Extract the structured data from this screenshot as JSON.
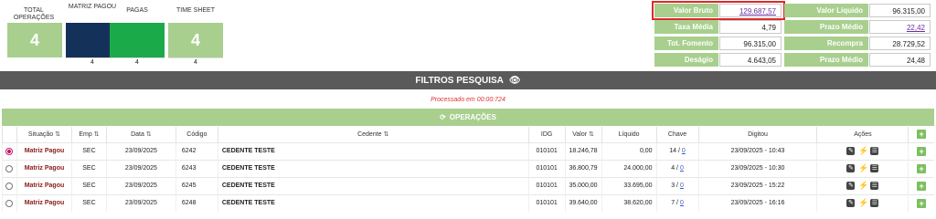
{
  "cards": [
    {
      "label": "TOTAL OPERAÇÕES",
      "value": "4",
      "color": "#a8cf8e",
      "count": ""
    },
    {
      "label": "MATRIZ PAGOU",
      "value": "",
      "color": "#14315a",
      "count": "4"
    },
    {
      "label": "PAGAS",
      "value": "",
      "color": "#1aaa4a",
      "count": "4"
    },
    {
      "label": "TIME SHEET",
      "value": "4",
      "color": "#a8cf8e",
      "count": "4"
    }
  ],
  "summary": {
    "valor_bruto_label": "Valor Bruto",
    "valor_bruto": "129.687,57",
    "valor_liquido_label": "Valor Líquido",
    "valor_liquido": "96.315,00",
    "taxa_media_label": "Taxa Média",
    "taxa_media": "4,79",
    "prazo_medio_label": "Prazo Médio",
    "prazo_medio": "22,42",
    "tot_fomento_label": "Tot. Fomento",
    "tot_fomento": "96.315,00",
    "recompra_label": "Recompra",
    "recompra": "28.729,52",
    "desagio_label": "Deságio",
    "desagio": "4.643,05",
    "prazo_pond_label": "Prazo Médio Ponderado",
    "prazo_pond": "24,48"
  },
  "filter_title": "FILTROS PESQUISA",
  "processed_text": "Processado em 00:00:724",
  "ops_title": "OPERAÇÕES",
  "columns": {
    "situacao": "Situação",
    "emp": "Emp",
    "data": "Data",
    "codigo": "Código",
    "cedente": "Cedente",
    "idg": "IDG",
    "valor": "Valor",
    "liquido": "Líquido",
    "chave": "Chave",
    "digitou": "Digitou",
    "acoes": "Ações"
  },
  "rows": [
    {
      "situacao": "Matriz Pagou",
      "emp": "SEC",
      "data": "23/09/2025",
      "codigo": "6242",
      "cedente": "CEDENTE TESTE",
      "idg": "010101",
      "valor": "18.246,78",
      "liquido": "0,00",
      "chave_a": "14 /",
      "chave_b": "0",
      "digitou": "23/09/2025 - 10:43",
      "selected": true
    },
    {
      "situacao": "Matriz Pagou",
      "emp": "SEC",
      "data": "23/09/2025",
      "codigo": "6243",
      "cedente": "CEDENTE TESTE",
      "idg": "010101",
      "valor": "36.800,79",
      "liquido": "24.000,00",
      "chave_a": "4 /",
      "chave_b": "0",
      "digitou": "23/09/2025 - 10:30",
      "selected": false
    },
    {
      "situacao": "Matriz Pagou",
      "emp": "SEC",
      "data": "23/09/2025",
      "codigo": "6245",
      "cedente": "CEDENTE TESTE",
      "idg": "010101",
      "valor": "35.000,00",
      "liquido": "33.695,00",
      "chave_a": "3 /",
      "chave_b": "0",
      "digitou": "23/09/2025 - 15:22",
      "selected": false
    },
    {
      "situacao": "Matriz Pagou",
      "emp": "SEC",
      "data": "23/09/2025",
      "codigo": "6248",
      "cedente": "CEDENTE TESTE",
      "idg": "010101",
      "valor": "39.640,00",
      "liquido": "38.620,00",
      "chave_a": "7 /",
      "chave_b": "0",
      "digitou": "23/09/2025 - 16:16",
      "selected": false
    }
  ]
}
